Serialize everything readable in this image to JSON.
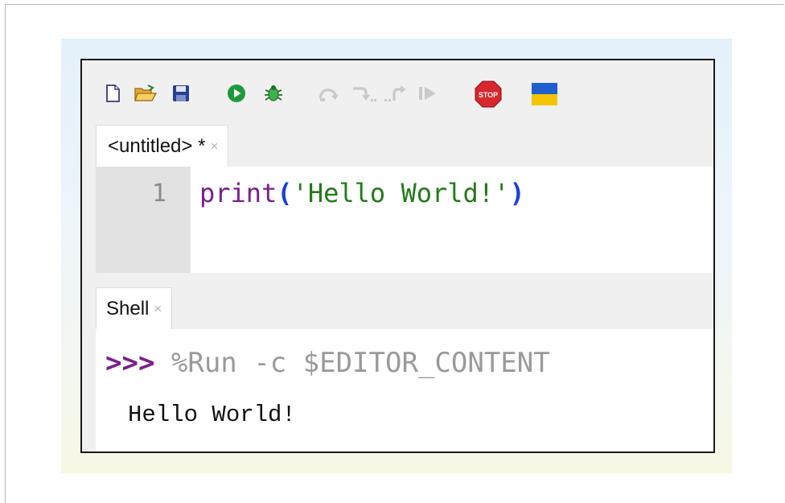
{
  "toolbar": {
    "buttons": [
      {
        "name": "new-file",
        "icon": "new-file-icon"
      },
      {
        "name": "open-file",
        "icon": "folder-open-icon"
      },
      {
        "name": "save-file",
        "icon": "save-icon"
      },
      {
        "name": "run",
        "icon": "run-icon"
      },
      {
        "name": "debug",
        "icon": "bug-icon"
      },
      {
        "name": "step-over",
        "icon": "step-over-icon"
      },
      {
        "name": "step-into",
        "icon": "step-into-icon"
      },
      {
        "name": "step-out",
        "icon": "step-out-icon"
      },
      {
        "name": "resume",
        "icon": "resume-icon"
      },
      {
        "name": "stop",
        "icon": "stop-icon",
        "label": "STOP"
      },
      {
        "name": "ukraine-flag",
        "icon": "flag-icon"
      }
    ],
    "colors": {
      "run": "#1e9a3c",
      "stop": "#d8262d",
      "flag_blue": "#1f5fd0",
      "flag_yellow": "#f5c400"
    }
  },
  "editor": {
    "tab_label": "<untitled> *",
    "tab_close": "×",
    "line_number": "1",
    "code": {
      "fn": "print",
      "open": "(",
      "string": "'Hello World!'",
      "close": ")"
    }
  },
  "shell": {
    "tab_label": "Shell",
    "tab_close": "×",
    "prompt": ">>>",
    "command": " %Run -c $EDITOR_CONTENT",
    "output": "Hello World!"
  }
}
